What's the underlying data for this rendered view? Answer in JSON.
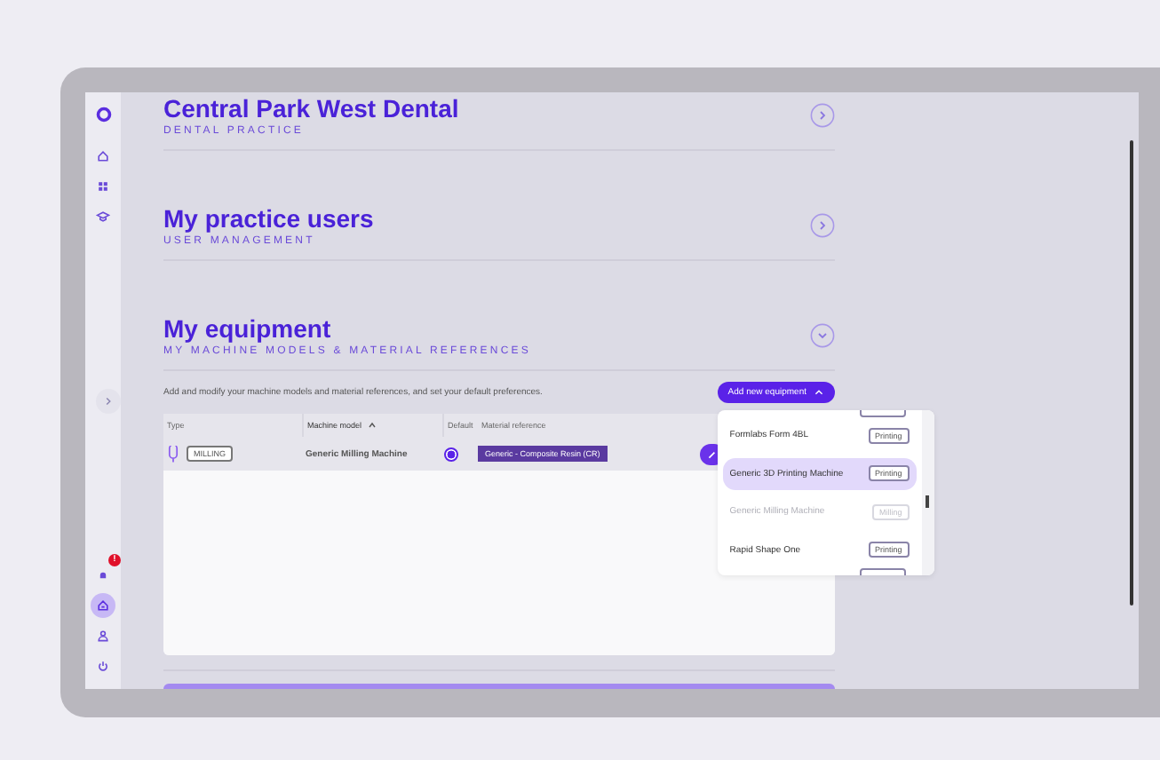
{
  "sidebar": {
    "top_items": [
      {
        "kind": "home",
        "selected": false
      },
      {
        "kind": "grid",
        "selected": false
      },
      {
        "kind": "cap",
        "selected": false
      }
    ],
    "bottom_items": [
      {
        "kind": "bell",
        "badge": "!",
        "selected": false
      },
      {
        "kind": "clinic",
        "selected": true
      },
      {
        "kind": "user",
        "selected": false
      },
      {
        "kind": "power",
        "selected": false
      }
    ]
  },
  "sections": [
    {
      "title": "Central Park West Dental",
      "subtitle": "DENTAL PRACTICE",
      "expanded": false
    },
    {
      "title": "My practice users",
      "subtitle": "USER MANAGEMENT",
      "expanded": false
    },
    {
      "title": "My equipment",
      "subtitle": "MY MACHINE MODELS & MATERIAL REFERENCES",
      "expanded": true
    }
  ],
  "equipment": {
    "description": "Add and modify your machine models and material references, and set your default preferences.",
    "add_button": {
      "label": "Add new equipment",
      "expanded": true
    },
    "table": {
      "columns": [
        {
          "label": "Type",
          "sorted": false
        },
        {
          "label": "Machine model",
          "sorted": true
        },
        {
          "label": "Default",
          "sorted": false
        },
        {
          "label": "Material reference",
          "sorted": false
        }
      ],
      "rows": [
        {
          "type": "MILLING",
          "model": "Generic Milling Machine",
          "default": true,
          "material": "Generic - Composite Resin (CR)"
        }
      ]
    },
    "dropdown": [
      {
        "name": "Formlabs Form 4BL",
        "tag": "Printing",
        "selected": false,
        "disabled": false
      },
      {
        "name": "Generic 3D Printing Machine",
        "tag": "Printing",
        "selected": true,
        "disabled": false
      },
      {
        "name": "Generic Milling Machine",
        "tag": "Milling",
        "selected": false,
        "disabled": true
      },
      {
        "name": "Rapid Shape One",
        "tag": "Printing",
        "selected": false,
        "disabled": false
      }
    ]
  }
}
